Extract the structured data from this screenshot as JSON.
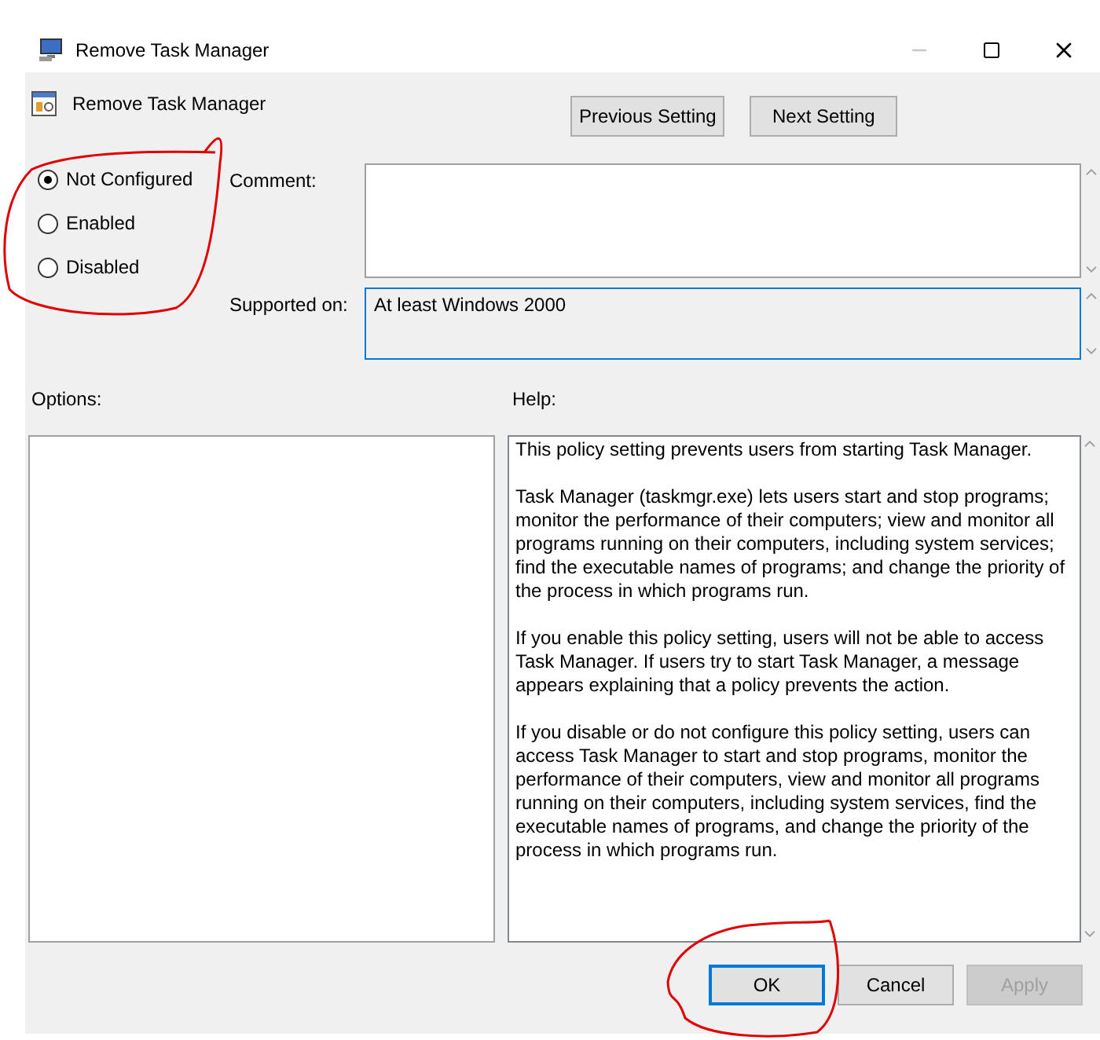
{
  "window": {
    "title": "Remove Task Manager"
  },
  "policy": {
    "title": "Remove Task Manager"
  },
  "nav_buttons": [
    {
      "label": "Previous Setting"
    },
    {
      "label": "Next Setting"
    }
  ],
  "states": [
    {
      "label": "Not Configured",
      "selected": true
    },
    {
      "label": "Enabled",
      "selected": false
    },
    {
      "label": "Disabled",
      "selected": false
    }
  ],
  "comment": {
    "label": "Comment:"
  },
  "supported_on": {
    "label": "Supported on:",
    "value": "At least Windows 2000"
  },
  "options": {
    "label": "Options:"
  },
  "help": {
    "label": "Help:",
    "paragraphs": [
      "This policy setting prevents users from starting Task Manager.",
      "Task Manager (taskmgr.exe) lets users start and stop programs; monitor the performance of their computers; view and monitor all programs running on their computers, including system services; find the executable names of programs; and change the priority of the process in which programs run.",
      "If you enable this policy setting, users will not be able to access Task Manager. If users try to start Task Manager, a message appears explaining that a policy prevents the action.",
      "If you disable or do not configure this policy setting, users can access Task Manager to  start and stop programs, monitor the performance of their computers, view and monitor all programs running on their computers, including system services, find the executable names of programs, and change the priority of the process in which programs run."
    ]
  },
  "buttons": [
    {
      "label": "OK",
      "kind": "default",
      "disabled": false
    },
    {
      "label": "Cancel",
      "kind": "normal",
      "disabled": false
    },
    {
      "label": "Apply",
      "kind": "normal",
      "disabled": true
    }
  ]
}
